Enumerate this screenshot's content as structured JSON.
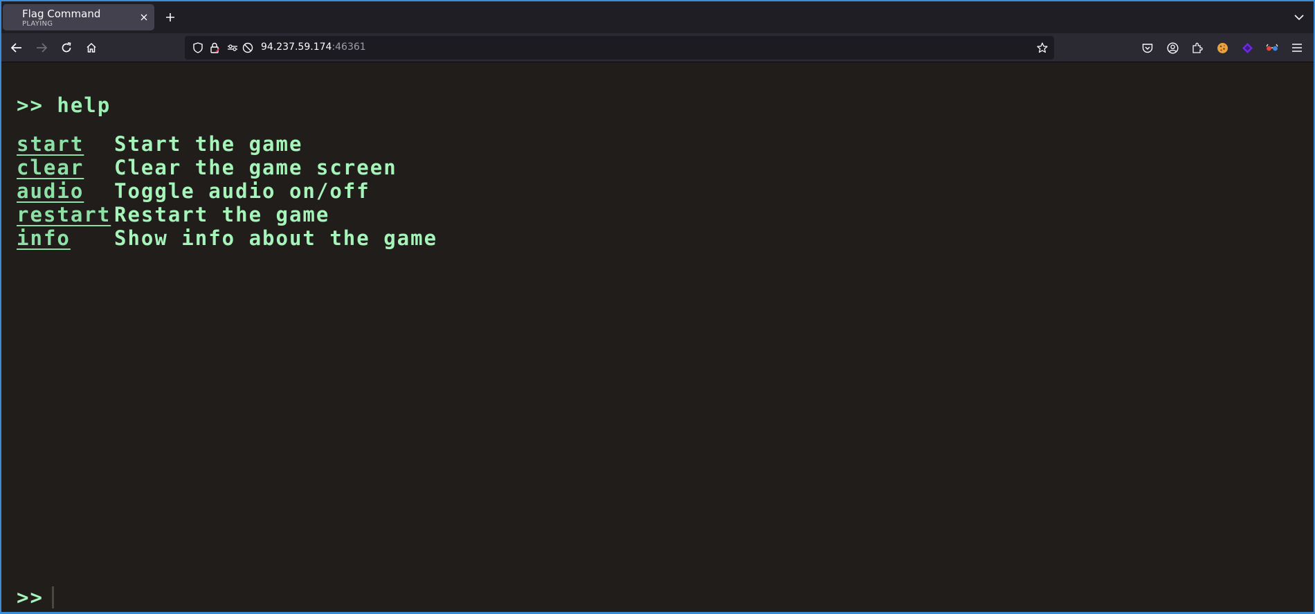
{
  "browser": {
    "tab": {
      "title": "Flag Command",
      "subtitle": "PLAYING"
    },
    "url": {
      "host": "94.237.59.174",
      "port": ":46361"
    },
    "icons": {
      "tab_close": "close-icon",
      "new_tab": "plus-icon",
      "tab_list": "chevron-down-icon",
      "back": "back-arrow-icon",
      "forward": "forward-arrow-icon",
      "reload": "reload-icon",
      "home": "home-icon",
      "tracking": "shield-icon",
      "security": "lock-icon",
      "permissions": "permissions-icon",
      "notifications_blocked": "blocked-icon",
      "bookmark": "star-icon",
      "pocket": "pocket-icon",
      "account": "account-icon",
      "extensions": "puzzle-icon",
      "extension_1": "cookie-extension-icon",
      "extension_2": "purple-extension-icon",
      "extension_3": "glasses-extension-icon",
      "menu": "hamburger-menu-icon"
    }
  },
  "terminal": {
    "echo": ">> help",
    "commands": [
      {
        "name": "start",
        "description": "Start the game"
      },
      {
        "name": "clear",
        "description": "Clear the game screen"
      },
      {
        "name": "audio",
        "description": "Toggle audio on/off"
      },
      {
        "name": "restart",
        "description": "Restart the game"
      },
      {
        "name": "info",
        "description": "Show info about the game"
      }
    ],
    "prompt": ">>",
    "input_value": ""
  },
  "colors": {
    "terminal_bg": "#201d1b",
    "terminal_text": "#a6f4ba",
    "command_link": "#8fe0a6",
    "window_border": "#3b8bd6"
  }
}
